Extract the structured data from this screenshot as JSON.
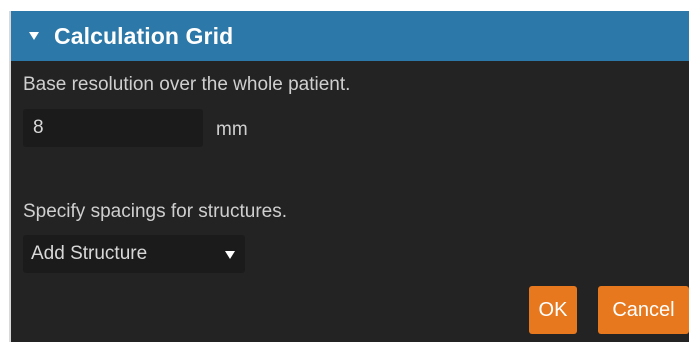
{
  "header": {
    "title": "Calculation Grid",
    "collapse_icon": "triangle-down-icon",
    "background": "#2c78a8"
  },
  "base_resolution": {
    "label": "Base resolution over the whole patient.",
    "value": "8",
    "unit": "mm"
  },
  "structures": {
    "label": "Specify spacings for structures.",
    "select_label": "Add Structure",
    "select_icon": "chevron-down-icon"
  },
  "buttons": {
    "ok_label": "OK",
    "cancel_label": "Cancel",
    "accent": "#e8781e"
  },
  "panel_background": "#232323"
}
